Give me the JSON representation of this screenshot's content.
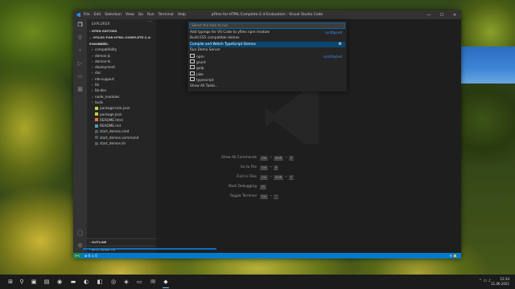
{
  "window": {
    "title": "pFiles-for-HTML-Complete-2.4-Evaluation - Visual Studio Code",
    "menu": [
      "File",
      "Edit",
      "Selection",
      "View",
      "Go",
      "Run",
      "Terminal",
      "Help"
    ],
    "controls": [
      "—",
      "☐",
      "✕"
    ]
  },
  "activity_bar": [
    "files-icon",
    "search-icon",
    "source-control-icon",
    "run-debug-icon",
    "remote-explorer-icon",
    "extensions-icon",
    "account-icon",
    "settings-gear-icon"
  ],
  "sidebar": {
    "header": "EXPLORER",
    "open_editors": "OPEN EDITORS",
    "folder": "YFILES-FOR-HTML-COMPLETE-2.4-EVALUATI...",
    "items": [
      {
        "label": ".vscode",
        "type": "folder"
      },
      {
        "label": "compatibility",
        "type": "folder"
      },
      {
        "label": "demos-js",
        "type": "folder"
      },
      {
        "label": "demos-ts",
        "type": "folder"
      },
      {
        "label": "deployment",
        "type": "folder"
      },
      {
        "label": "doc",
        "type": "folder"
      },
      {
        "label": "ide-support",
        "type": "folder"
      },
      {
        "label": "lib",
        "type": "folder"
      },
      {
        "label": "lib-dev",
        "type": "folder"
      },
      {
        "label": "node_modules",
        "type": "folder"
      },
      {
        "label": "tools",
        "type": "folder"
      },
      {
        "label": "package-lock.json",
        "type": "json"
      },
      {
        "label": "package.json",
        "type": "json"
      },
      {
        "label": "README.html",
        "type": "html"
      },
      {
        "label": "README.md",
        "type": "md"
      },
      {
        "label": "start_demos.cmd",
        "type": "cmd"
      },
      {
        "label": "start_demos.command",
        "type": "cmd"
      },
      {
        "label": "start_demos.sh",
        "type": "sh"
      }
    ],
    "outline": "OUTLINE",
    "npm_scripts": "NPM SCRIPTS"
  },
  "quick_pick": {
    "placeholder": "Select the task to run",
    "items": [
      {
        "label": "Add typings for VS Code to yfiles npm module",
        "tag": "configured"
      },
      {
        "label": "Build ES5 compatible demos",
        "tag": ""
      },
      {
        "label": "Compile and Watch TypeScript Demos",
        "tag": "",
        "selected": true
      },
      {
        "label": "Run Demo Server",
        "tag": ""
      },
      {
        "label": "npm",
        "tag": "contributed",
        "folder": true
      },
      {
        "label": "grunt",
        "tag": "",
        "folder": true
      },
      {
        "label": "gulp",
        "tag": "",
        "folder": true
      },
      {
        "label": "jake",
        "tag": "",
        "folder": true
      },
      {
        "label": "typescript",
        "tag": "",
        "folder": true
      },
      {
        "label": "Show All Tasks...",
        "tag": ""
      }
    ]
  },
  "shortcuts": [
    {
      "label": "Show All Commands",
      "keys": [
        "Ctrl",
        "Shift",
        "P"
      ]
    },
    {
      "label": "Go to File",
      "keys": [
        "Ctrl",
        "P"
      ]
    },
    {
      "label": "Find in Files",
      "keys": [
        "Ctrl",
        "Shift",
        "F"
      ]
    },
    {
      "label": "Start Debugging",
      "keys": [
        "F5"
      ]
    },
    {
      "label": "Toggle Terminal",
      "keys": [
        "Ctrl",
        "`"
      ]
    }
  ],
  "status_bar": {
    "remote": "><",
    "problems": "⊗ 0 ⚠ 0",
    "right": "⚲  🔔"
  },
  "taskbar": {
    "time": "12:34",
    "date": "21.06.2021"
  },
  "colors": {
    "accent": "#007acc",
    "selection": "#094771",
    "link": "#3794ff"
  }
}
